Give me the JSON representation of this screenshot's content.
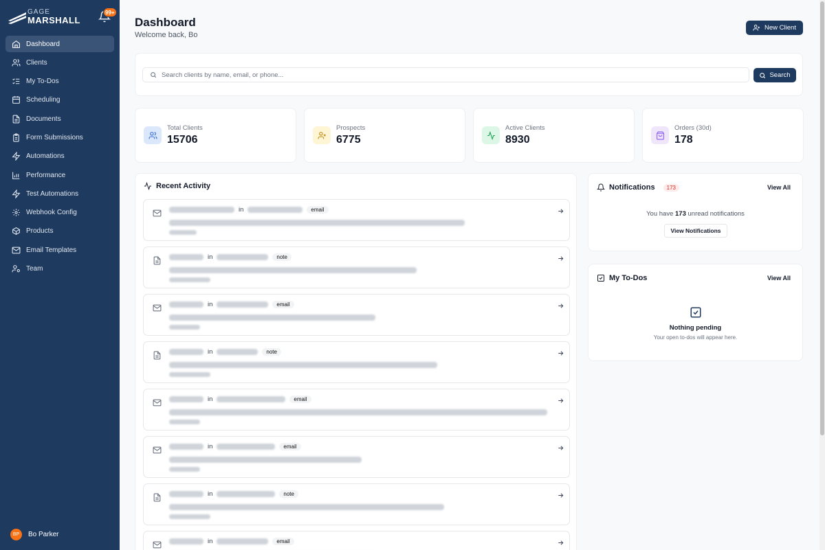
{
  "brand": {
    "line1": "GAGE",
    "line2": "MARSHALL"
  },
  "bell_badge": "99+",
  "sidebar": {
    "items": [
      {
        "label": "Dashboard",
        "icon": "home-icon"
      },
      {
        "label": "Clients",
        "icon": "users-icon"
      },
      {
        "label": "My To-Dos",
        "icon": "list-checks-icon"
      },
      {
        "label": "Scheduling",
        "icon": "calendar-icon"
      },
      {
        "label": "Documents",
        "icon": "file-icon"
      },
      {
        "label": "Form Submissions",
        "icon": "clipboard-icon"
      },
      {
        "label": "Automations",
        "icon": "zap-icon"
      },
      {
        "label": "Performance",
        "icon": "bar-chart-icon"
      },
      {
        "label": "Test Automations",
        "icon": "zap-icon"
      },
      {
        "label": "Webhook Config",
        "icon": "webhook-icon"
      },
      {
        "label": "Products",
        "icon": "package-icon"
      },
      {
        "label": "Email Templates",
        "icon": "mail-icon"
      },
      {
        "label": "Team",
        "icon": "user-cog-icon"
      }
    ],
    "active": "Dashboard"
  },
  "user": {
    "initials": "BP",
    "name": "Bo Parker"
  },
  "header": {
    "title": "Dashboard",
    "subtitle": "Welcome back, Bo",
    "new_client_label": "New Client"
  },
  "search": {
    "placeholder": "Search clients by name, email, or phone...",
    "button_label": "Search"
  },
  "stats": [
    {
      "label": "Total Clients",
      "value": "15706",
      "icon": "users-icon",
      "color": "#dbe7fb"
    },
    {
      "label": "Prospects",
      "value": "6775",
      "icon": "user-plus-icon",
      "color": "#fdf5d4"
    },
    {
      "label": "Active Clients",
      "value": "8930",
      "icon": "activity-icon",
      "color": "#dcf7e6"
    },
    {
      "label": "Orders (30d)",
      "value": "178",
      "icon": "shopping-bag-icon",
      "color": "#efe6fb"
    }
  ],
  "activity": {
    "title": "Recent Activity",
    "connector": "in",
    "items": [
      {
        "type": "email",
        "icon": "mail-icon"
      },
      {
        "type": "note",
        "icon": "file-text-icon"
      },
      {
        "type": "email",
        "icon": "mail-icon"
      },
      {
        "type": "note",
        "icon": "file-text-icon"
      },
      {
        "type": "email",
        "icon": "mail-icon"
      },
      {
        "type": "email",
        "icon": "mail-icon"
      },
      {
        "type": "note",
        "icon": "file-text-icon"
      },
      {
        "type": "email",
        "icon": "mail-icon"
      }
    ]
  },
  "notifications": {
    "title": "Notifications",
    "count": "173",
    "view_all": "View All",
    "text_before": "You have",
    "text_count": "173",
    "text_after": "unread notifications",
    "button": "View Notifications"
  },
  "todos": {
    "title": "My To-Dos",
    "view_all": "View All",
    "empty_title": "Nothing pending",
    "empty_sub": "Your open to-dos will appear here."
  }
}
